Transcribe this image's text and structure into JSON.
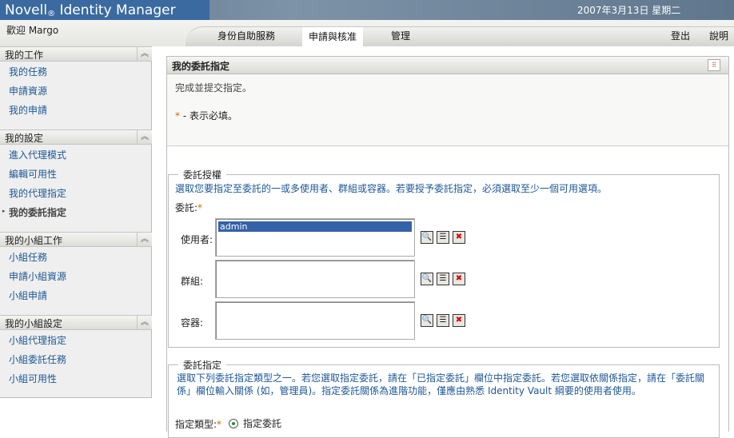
{
  "header": {
    "brand": "Novell",
    "brand_mark": "®",
    "product": " Identity Manager",
    "date": "2007年3月13日  星期二"
  },
  "nav": {
    "welcome": "歡迎  Margo",
    "tabs": [
      {
        "label": "身份自助服務"
      },
      {
        "label": "申請與核准",
        "active": true
      },
      {
        "label": "管理"
      }
    ],
    "logout": "登出",
    "help": "說明"
  },
  "sidebar": {
    "sections": [
      {
        "title": "我的工作",
        "items": [
          "我的任務",
          "申請資源",
          "我的申請"
        ]
      },
      {
        "title": "我的設定",
        "items": [
          "進入代理模式",
          "編輯可用性",
          "我的代理指定",
          "我的委託指定"
        ],
        "current": 3
      },
      {
        "title": "我的小組工作",
        "items": [
          "小組任務",
          "申請小組資源",
          "小組申請"
        ]
      },
      {
        "title": "我的小組設定",
        "items": [
          "小組代理指定",
          "小組委託任務",
          "小組可用性"
        ]
      }
    ]
  },
  "panel": {
    "title": "我的委託指定",
    "intro": "完成並提交指定。",
    "required_mark": "*",
    "required_note": " - 表示必填。",
    "grant": {
      "legend": "委託授權",
      "help": "選取您要指定至委託的一或多使用者、群組或容器。若要授予委託指定，必須選取至少一個可用選項。",
      "delegate_label": "委託:",
      "users_label": "使用者:",
      "users": [
        "admin"
      ],
      "groups_label": "群組:",
      "containers_label": "容器:"
    },
    "assign": {
      "legend": "委託指定",
      "help": "選取下列委託指定類型之一。若您選取指定委託，請在「已指定委託」欄位中指定委託。若您選取依關係指定，請在「委託關係」欄位輸入關係 (如，管理員)。指定委託關係為進階功能，僅應由熟悉 Identity Vault 綱要的使用者使用。",
      "type_label": "指定類型:",
      "option": "指定委託"
    }
  }
}
